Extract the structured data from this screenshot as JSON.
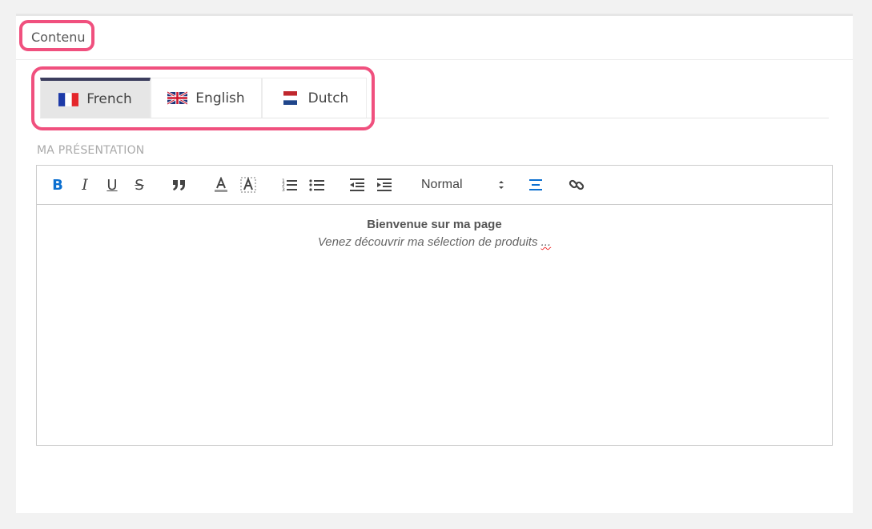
{
  "panel": {
    "title": "Contenu"
  },
  "tabs": [
    {
      "label": "French",
      "flag": "france-flag",
      "active": true
    },
    {
      "label": "English",
      "flag": "uk-flag",
      "active": false
    },
    {
      "label": "Dutch",
      "flag": "netherlands-flag",
      "active": false
    }
  ],
  "section": {
    "label": "MA PRÉSENTATION"
  },
  "toolbar": {
    "bold_label": "B",
    "italic_label": "I",
    "underline_label": "U",
    "strike_label": "S",
    "format_value": "Normal",
    "accent_color": "#0b6fd0"
  },
  "editor": {
    "line1": "Bienvenue sur ma page",
    "line2": "Venez découvrir ma sélection de produits",
    "line2_tail": "..."
  },
  "highlight_color": "#f0507e"
}
